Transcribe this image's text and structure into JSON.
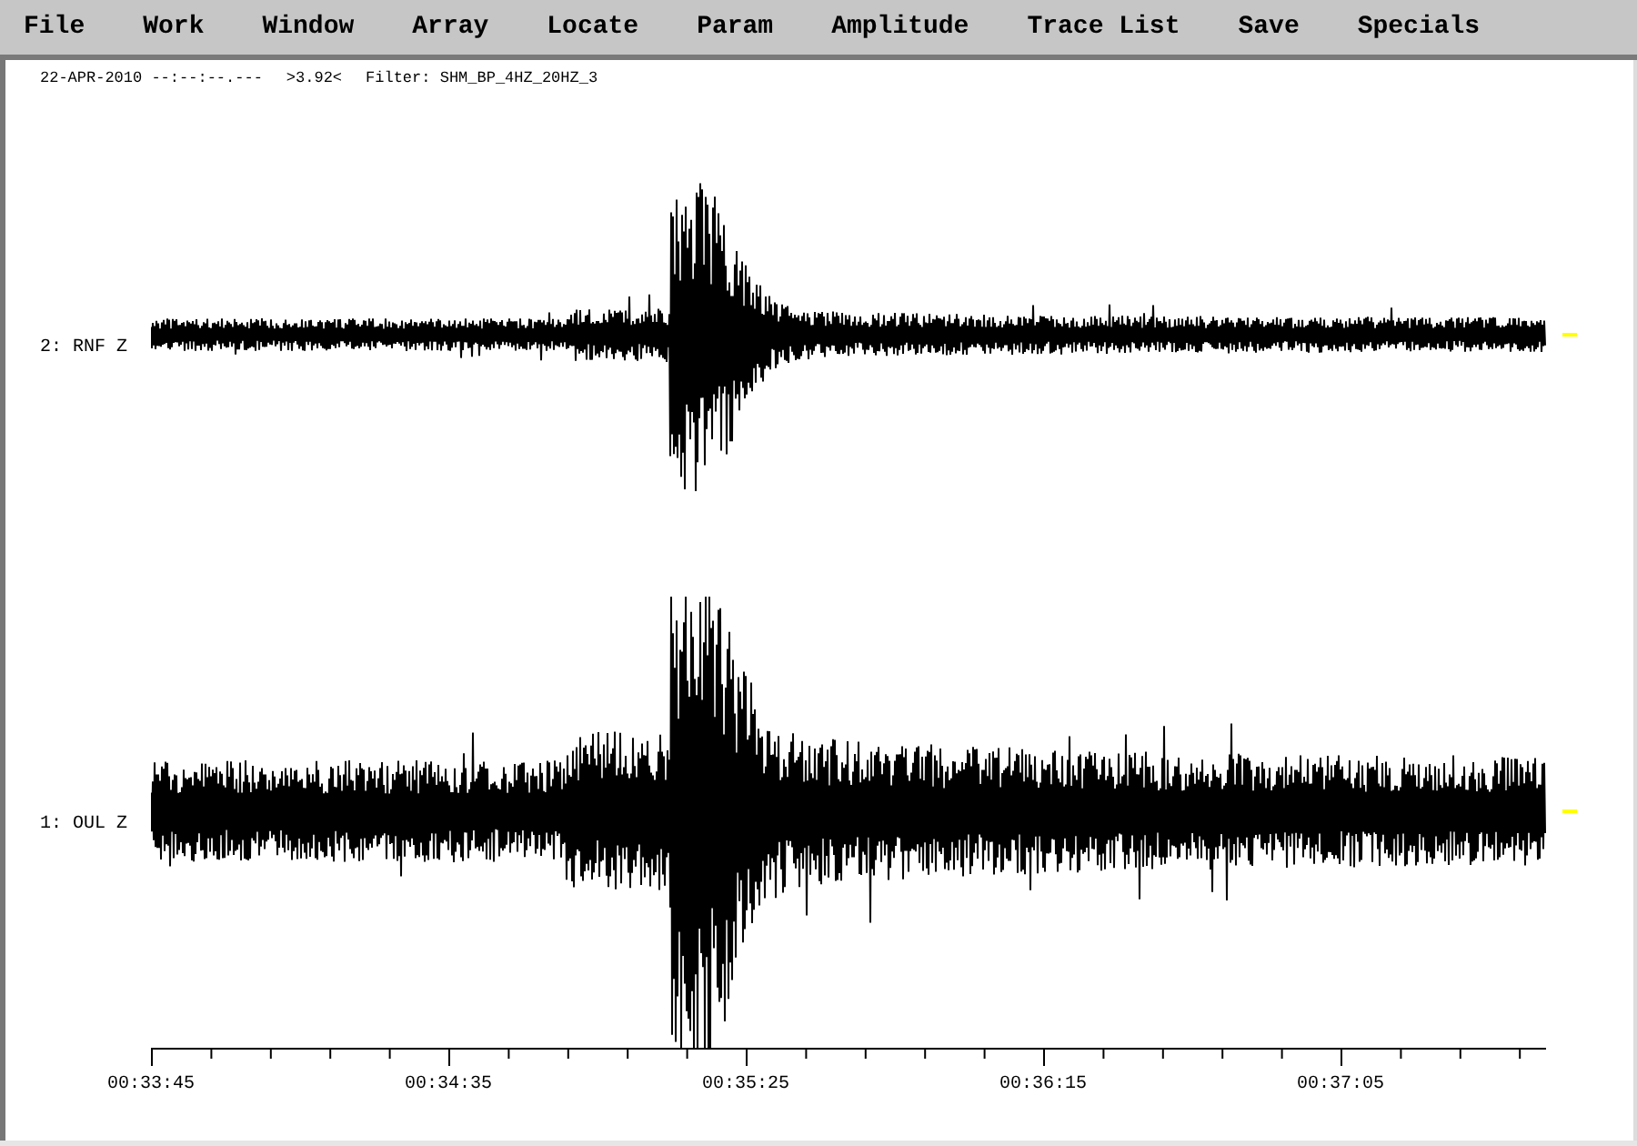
{
  "menu": [
    {
      "label": "File"
    },
    {
      "label": "Work"
    },
    {
      "label": "Window"
    },
    {
      "label": "Array"
    },
    {
      "label": "Locate"
    },
    {
      "label": "Param"
    },
    {
      "label": "Amplitude"
    },
    {
      "label": "Trace List"
    },
    {
      "label": "Save"
    },
    {
      "label": "Specials"
    }
  ],
  "header": {
    "date": "22-APR-2010 --:--:--.---",
    "scale": ">3.92<",
    "filter": "Filter: SHM_BP_4HZ_20HZ_3"
  },
  "traces": [
    {
      "label": "2: RNF Z"
    },
    {
      "label": "1: OUL Z"
    }
  ],
  "time_axis": {
    "labels": [
      "00:33:45",
      "00:34:35",
      "00:35:25",
      "00:36:15",
      "00:37:05"
    ]
  }
}
